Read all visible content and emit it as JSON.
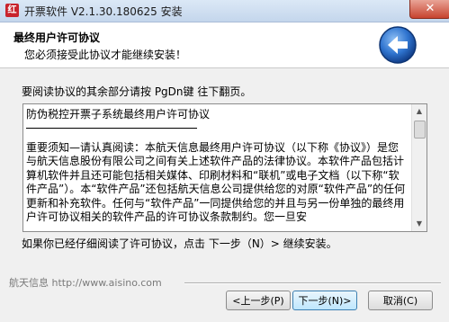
{
  "window": {
    "title": "开票软件 V2.1.30.180625 安装",
    "app_icon": "红",
    "close_symbol": "✕"
  },
  "header": {
    "title": "最终用户许可协议",
    "subtitle": "您必须接受此协议才能继续安装！",
    "icon": "back-arrow-icon",
    "accent": "#1f5fbf"
  },
  "instruction": "要阅读协议的其余部分请按 PgDn键 往下翻页。",
  "license": {
    "title": "防伪税控开票子系统最终用户许可协议",
    "body": "重要须知—请认真阅读：本航天信息最终用户许可协议（以下称《协议》）是您与航天信息股份有限公司之间有关上述软件产品的法律协议。本软件产品包括计算机软件并且还可能包括相关媒体、印刷材料和“联机”或电子文档（以下称“软件产品”）。本“软件产品”还包括航天信息公司提供给您的对原“软件产品”的任何更新和补充软件。任何与“软件产品”一同提供给您的并且与另一份单独的最终用户许可协议相关的软件产品的许可协议条款制约。您一旦安"
  },
  "hint": "如果你已经仔细阅读了许可协议，点击 下一步（N）> 继续安装。",
  "branding": "航天信息 http://www.aisino.com",
  "buttons": {
    "back": "<上一步(P)",
    "next": "下一步(N)>",
    "cancel": "取消(C)"
  }
}
